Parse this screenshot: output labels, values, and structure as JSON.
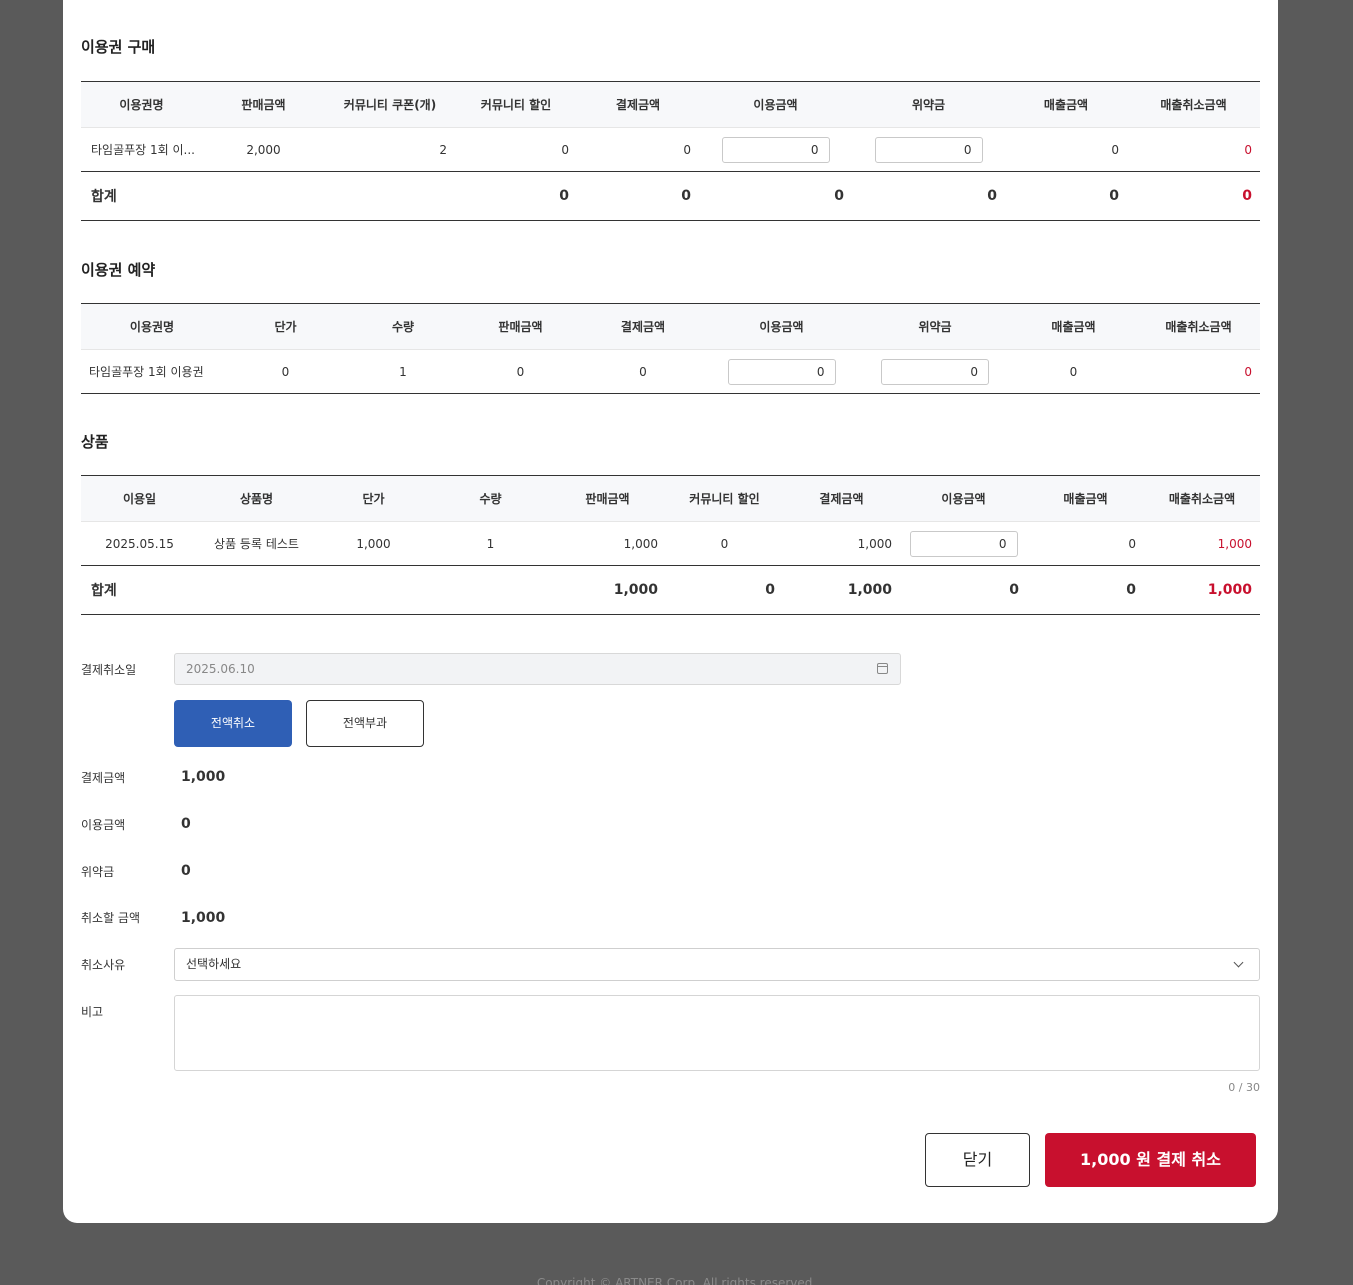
{
  "footer_text": "Copyright © ARTNER Corp. All rights reserved.",
  "purchase": {
    "title": "이용권 구매",
    "headers": [
      "이용권명",
      "판매금액",
      "커뮤니티 쿠폰(개)",
      "커뮤니티 할인",
      "결제금액",
      "이용금액",
      "위약금",
      "매출금액",
      "매출취소금액"
    ],
    "row": {
      "name": "타임골푸장 1회 이...",
      "sale": "2,000",
      "coupon": "2",
      "discount": "0",
      "payment": "0",
      "usage": "0",
      "penalty": "0",
      "revenue": "0",
      "revenue_cancel": "0"
    },
    "sum": {
      "label": "합계",
      "discount": "0",
      "payment": "0",
      "usage": "0",
      "penalty": "0",
      "revenue": "0",
      "revenue_cancel": "0"
    }
  },
  "reservation": {
    "title": "이용권 예약",
    "headers": [
      "이용권명",
      "단가",
      "수량",
      "판매금액",
      "결제금액",
      "이용금액",
      "위약금",
      "매출금액",
      "매출취소금액"
    ],
    "row": {
      "name": "타임골푸장 1회 이용권",
      "unit": "0",
      "qty": "1",
      "sale": "0",
      "payment": "0",
      "usage": "0",
      "penalty": "0",
      "revenue": "0",
      "revenue_cancel": "0"
    }
  },
  "product": {
    "title": "상품",
    "headers": [
      "이용일",
      "상품명",
      "단가",
      "수량",
      "판매금액",
      "커뮤니티 할인",
      "결제금액",
      "이용금액",
      "매출금액",
      "매출취소금액"
    ],
    "row": {
      "date": "2025.05.15",
      "name": "상품 등록 테스트",
      "unit": "1,000",
      "qty": "1",
      "sale": "1,000",
      "discount": "0",
      "payment": "1,000",
      "usage": "0",
      "revenue": "0",
      "revenue_cancel": "1,000"
    },
    "sum": {
      "label": "합계",
      "sale": "1,000",
      "discount": "0",
      "payment": "1,000",
      "usage": "0",
      "revenue": "0",
      "revenue_cancel": "1,000"
    }
  },
  "form": {
    "cancel_date_label": "결제취소일",
    "cancel_date_value": "2025.06.10",
    "full_cancel_label": "전액취소",
    "full_charge_label": "전액부과",
    "payment_label": "결제금액",
    "payment_value": "1,000",
    "usage_label": "이용금액",
    "usage_value": "0",
    "penalty_label": "위약금",
    "penalty_value": "0",
    "cancel_amount_label": "취소할 금액",
    "cancel_amount_value": "1,000",
    "reason_label": "취소사유",
    "reason_value": "선택하세요",
    "memo_label": "비고",
    "memo_counter": "0 / 30"
  },
  "actions": {
    "close_label": "닫기",
    "confirm_label": "1,000 원 결제 취소"
  },
  "colors": {
    "accent_blue": "#2f5fb5",
    "danger_red": "#c8102e"
  }
}
